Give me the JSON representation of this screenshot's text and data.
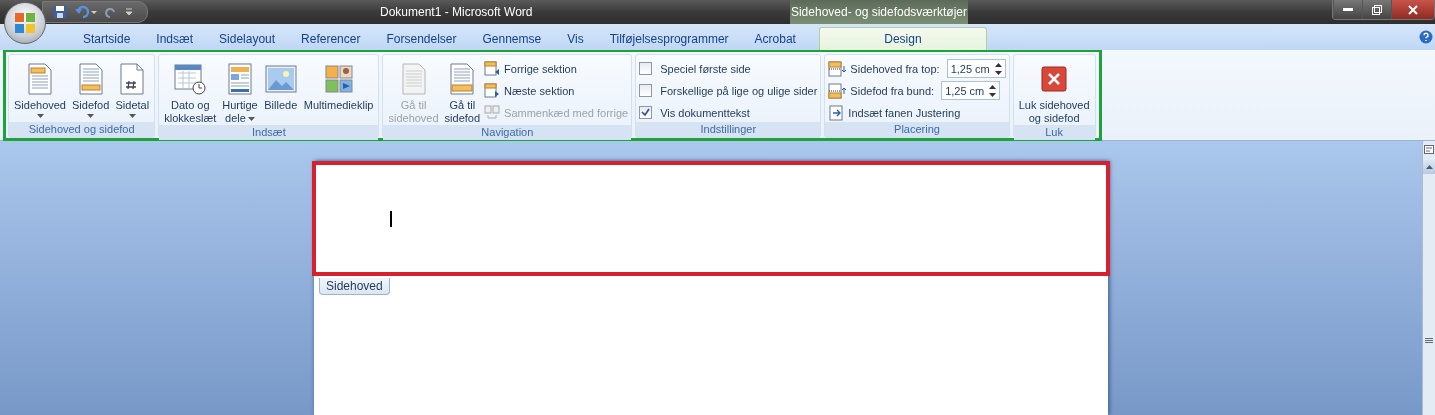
{
  "title_bar": {
    "document_title": "Dokument1 - Microsoft Word",
    "context_title": "Sidehoved- og sidefodsværktøjer"
  },
  "tabs": [
    {
      "label": "Startside",
      "selected": false,
      "kind": "normal"
    },
    {
      "label": "Indsæt",
      "selected": false,
      "kind": "normal"
    },
    {
      "label": "Sidelayout",
      "selected": false,
      "kind": "normal"
    },
    {
      "label": "Referencer",
      "selected": false,
      "kind": "normal"
    },
    {
      "label": "Forsendelser",
      "selected": false,
      "kind": "normal"
    },
    {
      "label": "Gennemse",
      "selected": false,
      "kind": "normal"
    },
    {
      "label": "Vis",
      "selected": false,
      "kind": "normal"
    },
    {
      "label": "Tilføjelsesprogrammer",
      "selected": false,
      "kind": "normal"
    },
    {
      "label": "Acrobat",
      "selected": false,
      "kind": "normal"
    },
    {
      "label": "Design",
      "selected": true,
      "kind": "contextual"
    }
  ],
  "ribbon": {
    "groups": [
      {
        "label": "Sidehoved og sidefod",
        "items": [
          {
            "kind": "large",
            "lines": [
              "Sidehoved"
            ],
            "dropdown": true,
            "disabled": false
          },
          {
            "kind": "large",
            "lines": [
              "Sidefod"
            ],
            "dropdown": true,
            "disabled": false
          },
          {
            "kind": "large",
            "lines": [
              "Sidetal"
            ],
            "dropdown": true,
            "disabled": false
          }
        ]
      },
      {
        "label": "Indsæt",
        "items": [
          {
            "kind": "large",
            "lines": [
              "Dato og",
              "klokkeslæt"
            ],
            "dropdown": false,
            "disabled": false
          },
          {
            "kind": "large",
            "lines": [
              "Hurtige",
              "dele"
            ],
            "dropdown": true,
            "disabled": false
          },
          {
            "kind": "large",
            "lines": [
              "Billede"
            ],
            "dropdown": false,
            "disabled": false
          },
          {
            "kind": "large",
            "lines": [
              "Multimedieklip"
            ],
            "dropdown": false,
            "disabled": false
          }
        ]
      },
      {
        "label": "Navigation",
        "items": [
          {
            "kind": "large",
            "lines": [
              "Gå til",
              "sidehoved"
            ],
            "dropdown": false,
            "disabled": true
          },
          {
            "kind": "large",
            "lines": [
              "Gå til",
              "sidefod"
            ],
            "dropdown": false,
            "disabled": false
          },
          {
            "kind": "small",
            "label": "Forrige sektion",
            "disabled": false
          },
          {
            "kind": "small",
            "label": "Næste sektion",
            "disabled": false
          },
          {
            "kind": "small",
            "label": "Sammenkæd med forrige",
            "disabled": true
          }
        ]
      },
      {
        "label": "Indstillinger",
        "items": [
          {
            "kind": "checkbox",
            "label": "Speciel første side",
            "checked": false
          },
          {
            "kind": "checkbox",
            "label": "Forskellige på lige og ulige sider",
            "checked": false
          },
          {
            "kind": "checkbox",
            "label": "Vis dokumenttekst",
            "checked": true
          }
        ]
      },
      {
        "label": "Placering",
        "items": [
          {
            "kind": "spinner",
            "label": "Sidehoved fra top:",
            "value": "1,25 cm"
          },
          {
            "kind": "spinner",
            "label": "Sidefod fra bund:",
            "value": "1,25 cm"
          },
          {
            "kind": "small",
            "label": "Indsæt fanen Justering",
            "disabled": false
          }
        ]
      },
      {
        "label": "Luk",
        "items": [
          {
            "kind": "large",
            "lines": [
              "Luk sidehoved",
              "og sidefod"
            ],
            "dropdown": false,
            "disabled": false
          }
        ]
      }
    ]
  },
  "document": {
    "header_tag": "Sidehoved"
  }
}
